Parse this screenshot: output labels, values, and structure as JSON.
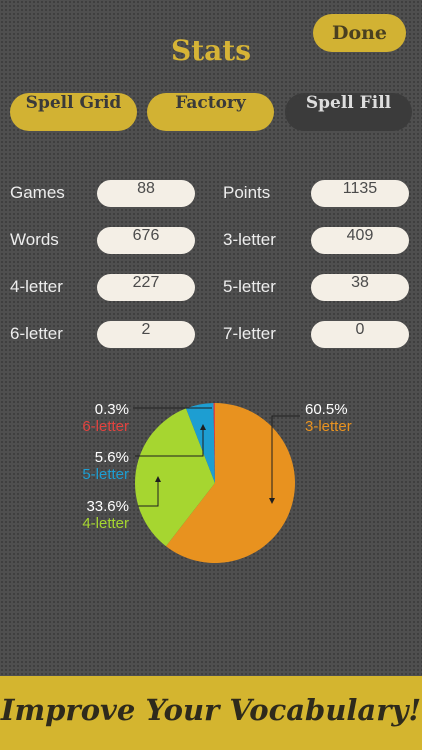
{
  "header": {
    "title": "Stats",
    "done_label": "Done"
  },
  "tabs": [
    {
      "label": "Spell Grid",
      "active": true
    },
    {
      "label": "Factory",
      "active": true
    },
    {
      "label": "Spell Fill",
      "active": false
    }
  ],
  "stats": {
    "left": [
      {
        "label": "Games",
        "value": "88"
      },
      {
        "label": "Words",
        "value": "676"
      },
      {
        "label": "4-letter",
        "value": "227"
      },
      {
        "label": "6-letter",
        "value": "2"
      }
    ],
    "right": [
      {
        "label": "Points",
        "value": "1135"
      },
      {
        "label": "3-letter",
        "value": "409"
      },
      {
        "label": "5-letter",
        "value": "38"
      },
      {
        "label": "7-letter",
        "value": "0"
      }
    ]
  },
  "chart_data": {
    "type": "pie",
    "slices": [
      {
        "label": "3-letter",
        "percent_label": "60.5%",
        "value": 60.5,
        "color": "#e8921f"
      },
      {
        "label": "4-letter",
        "percent_label": "33.6%",
        "value": 33.6,
        "color": "#a6d630"
      },
      {
        "label": "5-letter",
        "percent_label": "5.6%",
        "value": 5.6,
        "color": "#1d9ed2"
      },
      {
        "label": "6-letter",
        "percent_label": "0.3%",
        "value": 0.3,
        "color": "#e2433f"
      }
    ]
  },
  "banner": {
    "text": "Improve Your Vocabulary!"
  }
}
